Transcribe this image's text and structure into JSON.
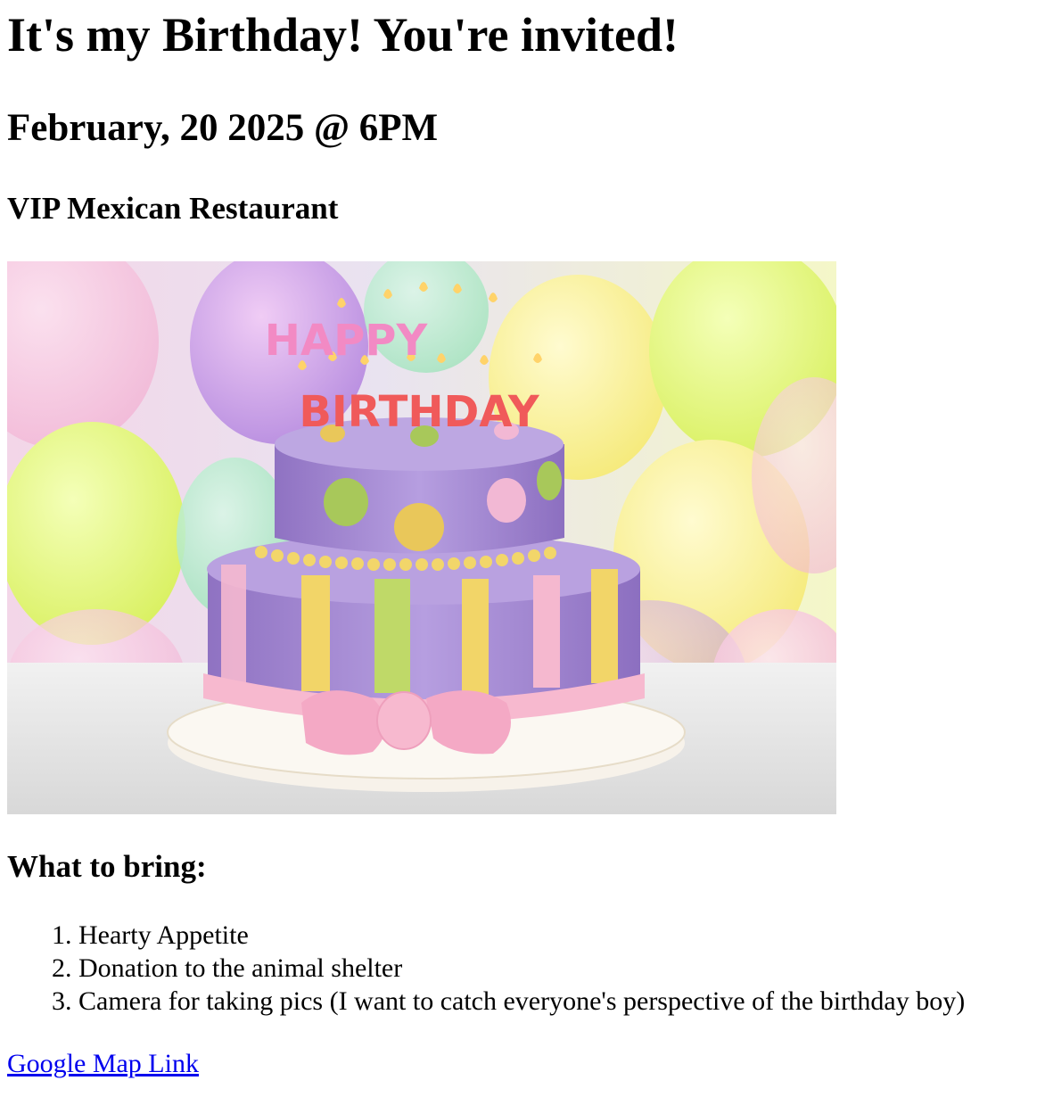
{
  "title": "It's my Birthday! You're invited!",
  "datetime": "February, 20 2025 @ 6PM",
  "venue": "VIP Mexican Restaurant",
  "image": {
    "subject": "birthday-cake-photo",
    "candle_text_top": "HAPPY",
    "candle_text_bottom": "BIRTHDAY"
  },
  "bring": {
    "heading": "What to bring:",
    "items": [
      "Hearty Appetite",
      "Donation to the animal shelter",
      "Camera for taking pics (I want to catch everyone's perspective of the birthday boy)"
    ]
  },
  "link": {
    "label": "Google Map Link",
    "color": "#0000ee"
  }
}
